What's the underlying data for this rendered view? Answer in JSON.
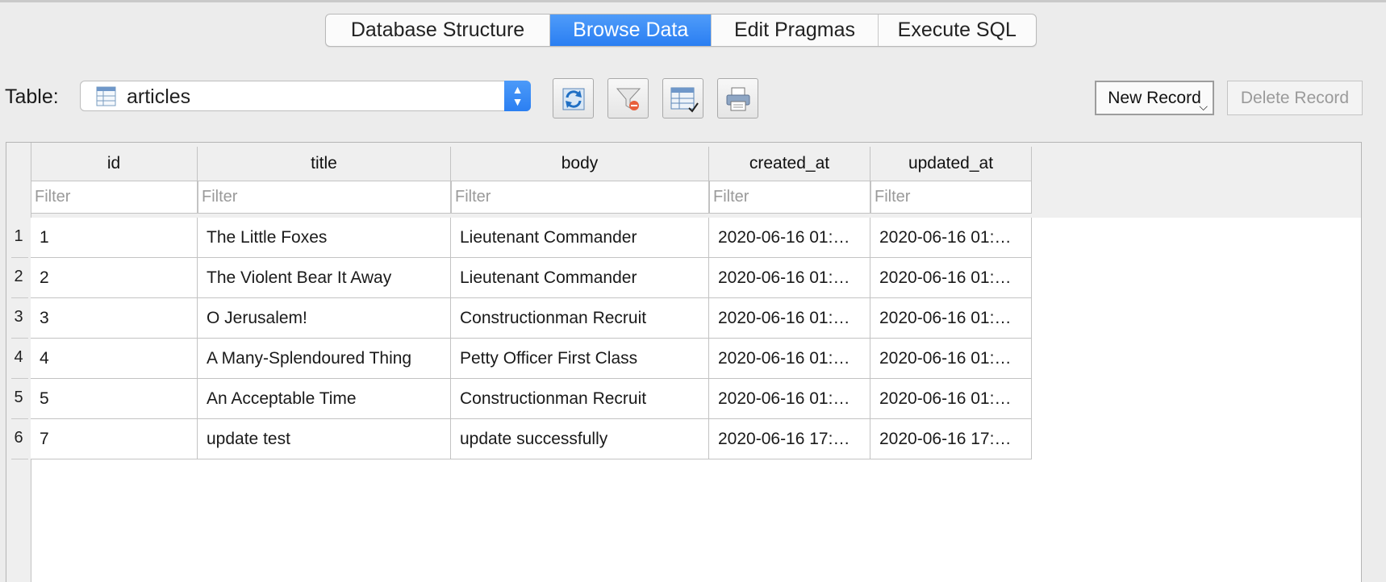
{
  "tabs": [
    {
      "label": "Database Structure",
      "active": false
    },
    {
      "label": "Browse Data",
      "active": true
    },
    {
      "label": "Edit Pragmas",
      "active": false
    },
    {
      "label": "Execute SQL",
      "active": false
    }
  ],
  "toolbar": {
    "table_label": "Table:",
    "selected_table": "articles",
    "buttons": [
      {
        "name": "refresh-button",
        "icon": "refresh-icon"
      },
      {
        "name": "clear-filters-button",
        "icon": "clear-filter-icon"
      },
      {
        "name": "save-table-button",
        "icon": "save-table-icon"
      },
      {
        "name": "print-button",
        "icon": "printer-icon"
      }
    ],
    "new_record": "New Record",
    "delete_record": "Delete Record"
  },
  "grid": {
    "columns": [
      "id",
      "title",
      "body",
      "created_at",
      "updated_at"
    ],
    "filter_placeholder": "Filter",
    "rows": [
      {
        "num": "1",
        "cells": [
          "1",
          "The Little Foxes",
          "Lieutenant Commander",
          "2020-06-16 01:…",
          "2020-06-16 01:…"
        ]
      },
      {
        "num": "2",
        "cells": [
          "2",
          "The Violent Bear It Away",
          "Lieutenant Commander",
          "2020-06-16 01:…",
          "2020-06-16 01:…"
        ]
      },
      {
        "num": "3",
        "cells": [
          "3",
          "O Jerusalem!",
          "Constructionman Recruit",
          "2020-06-16 01:…",
          "2020-06-16 01:…"
        ]
      },
      {
        "num": "4",
        "cells": [
          "4",
          "A Many-Splendoured Thing",
          "Petty Officer First Class",
          "2020-06-16 01:…",
          "2020-06-16 01:…"
        ]
      },
      {
        "num": "5",
        "cells": [
          "5",
          "An Acceptable Time",
          "Constructionman Recruit",
          "2020-06-16 01:…",
          "2020-06-16 01:…"
        ]
      },
      {
        "num": "6",
        "cells": [
          "7",
          "update test",
          "update successfully",
          "2020-06-16 17:…",
          "2020-06-16 17:…"
        ]
      }
    ]
  },
  "colors": {
    "accent": "#2a7ef2",
    "grid_line": "#c3c3c3"
  }
}
